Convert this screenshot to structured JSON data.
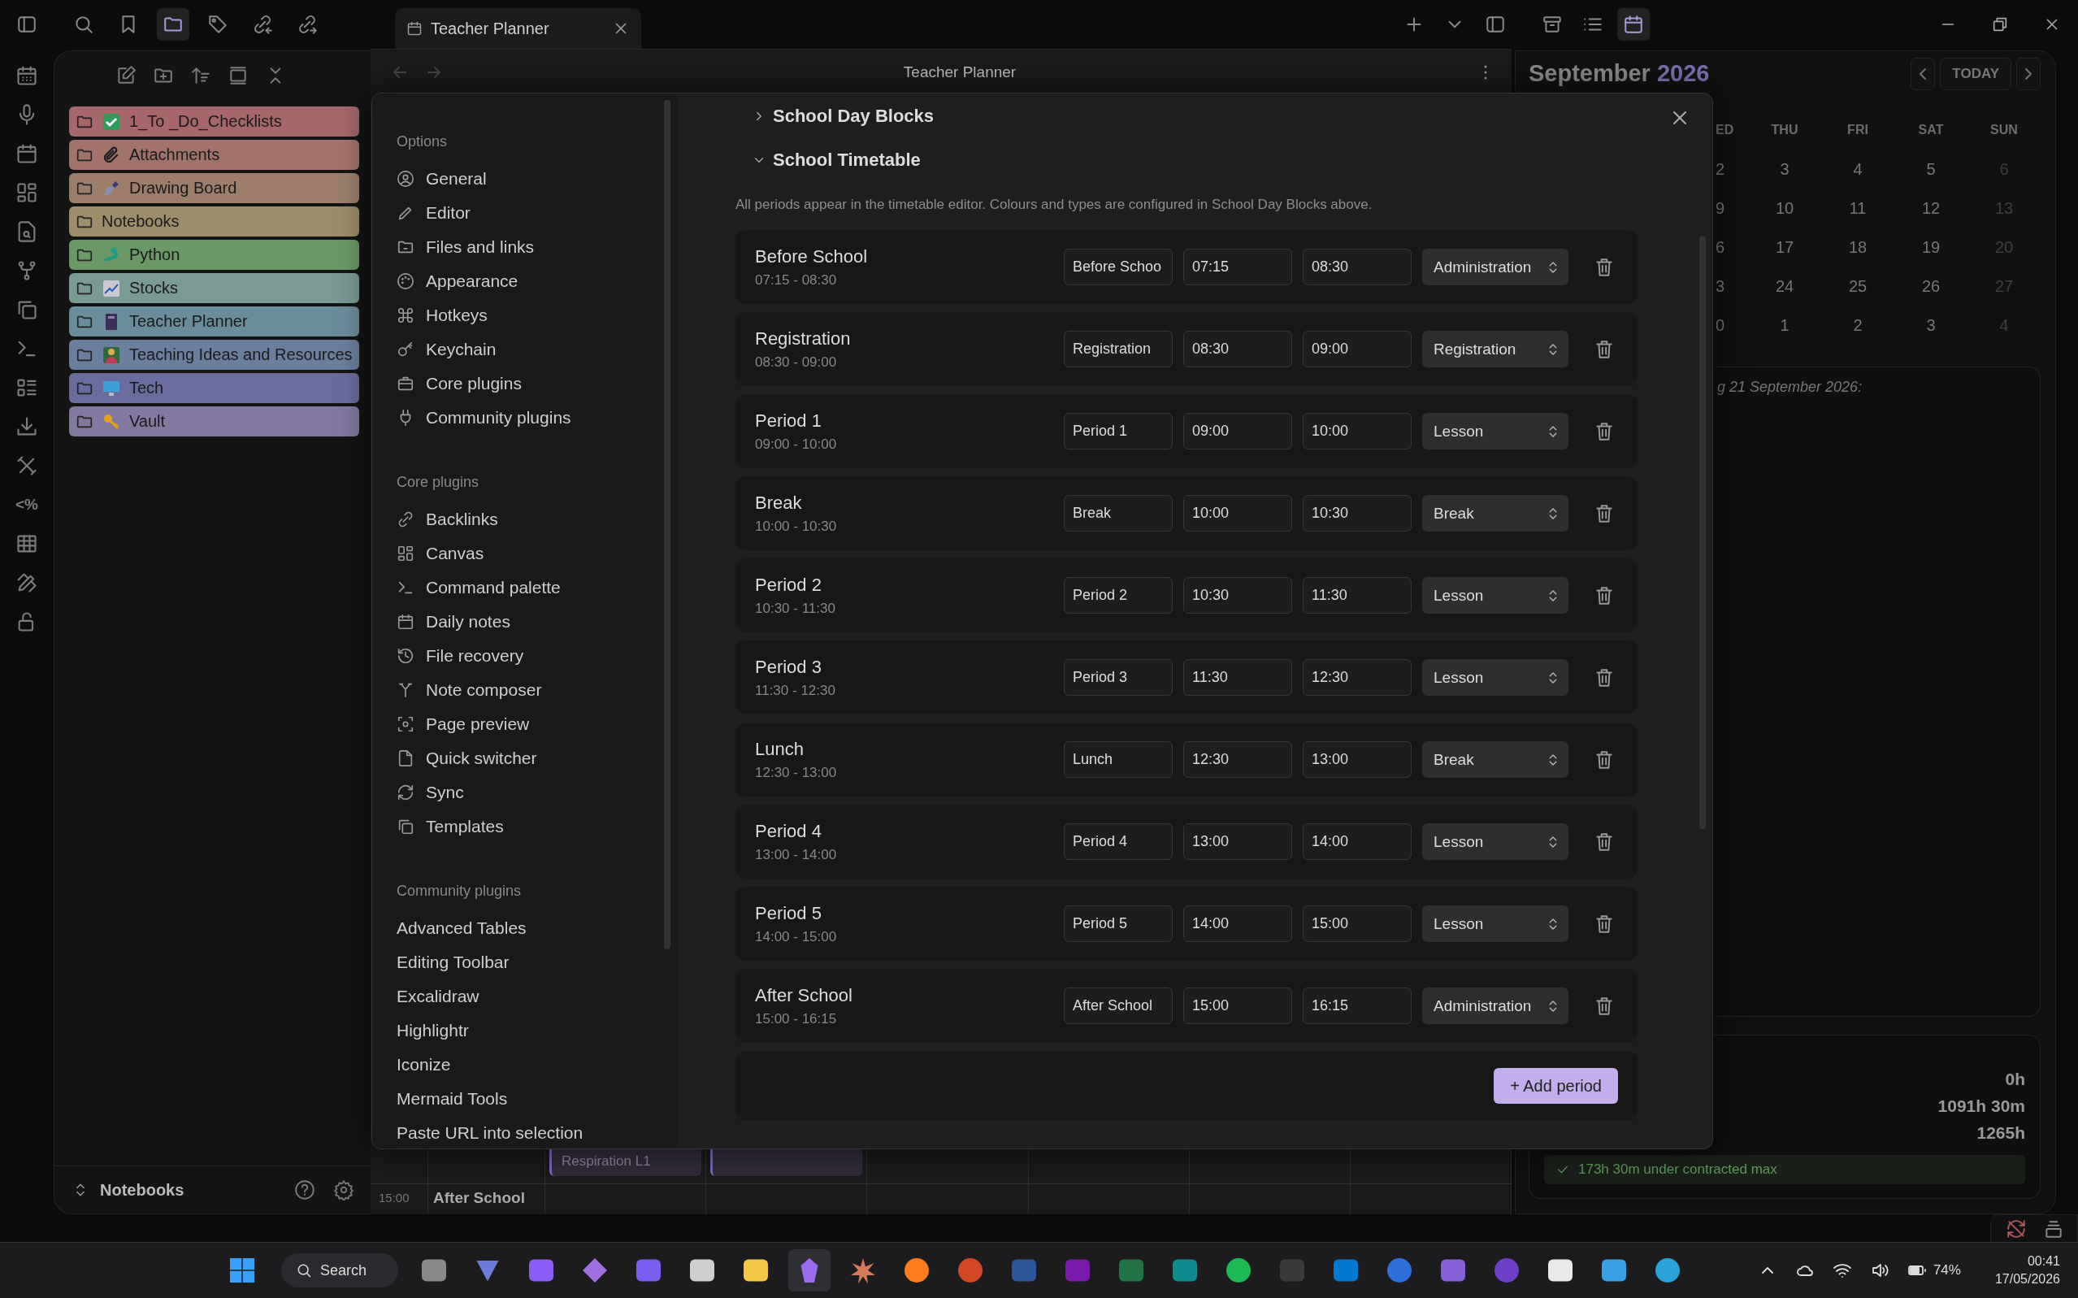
{
  "top_bar": {
    "tabs": [
      {
        "label": "Teacher Planner",
        "selected": true
      }
    ]
  },
  "ribbon": {
    "text_icon": "<%"
  },
  "file_explorer": {
    "folders": [
      {
        "name": "1_To _Do_Checklists",
        "color": "#a5676a"
      },
      {
        "name": "Attachments",
        "color": "#a2736b"
      },
      {
        "name": "Drawing Board",
        "color": "#9c7e6b"
      },
      {
        "name": "Notebooks",
        "color": "#9d8d69"
      },
      {
        "name": "Python",
        "color": "#6a9966"
      },
      {
        "name": "Stocks",
        "color": "#7a9a96"
      },
      {
        "name": "Teacher Planner",
        "color": "#6a8d9b"
      },
      {
        "name": "Teaching Ideas and Resources",
        "color": "#6a7f9f"
      },
      {
        "name": "Tech",
        "color": "#6a6c9e"
      },
      {
        "name": "Vault",
        "color": "#8278a0"
      }
    ],
    "vault": "Notebooks"
  },
  "view": {
    "title": "Teacher Planner",
    "timetable": {
      "time": "15:00",
      "row_label": "After School",
      "events": [
        {
          "kind": "titled",
          "title": "Respiration L1"
        },
        {
          "kind": "blank"
        }
      ]
    }
  },
  "settings_modal": {
    "nav": [
      {
        "heading": "Options",
        "items": [
          {
            "label": "General",
            "selected": false
          },
          {
            "label": "Editor",
            "selected": false
          },
          {
            "label": "Files and links",
            "selected": false
          },
          {
            "label": "Appearance",
            "selected": false
          },
          {
            "label": "Hotkeys",
            "selected": false
          },
          {
            "label": "Keychain",
            "selected": false
          },
          {
            "label": "Core plugins",
            "selected": false
          },
          {
            "label": "Community plugins",
            "selected": false
          }
        ]
      },
      {
        "heading": "Core plugins",
        "items": [
          {
            "label": "Backlinks",
            "selected": false
          },
          {
            "label": "Canvas",
            "selected": false
          },
          {
            "label": "Command palette",
            "selected": false
          },
          {
            "label": "Daily notes",
            "selected": false
          },
          {
            "label": "File recovery",
            "selected": false
          },
          {
            "label": "Note composer",
            "selected": false
          },
          {
            "label": "Page preview",
            "selected": false
          },
          {
            "label": "Quick switcher",
            "selected": false
          },
          {
            "label": "Sync",
            "selected": false
          },
          {
            "label": "Templates",
            "selected": false
          }
        ]
      },
      {
        "heading": "Community plugins",
        "items": [
          {
            "label": "Advanced Tables",
            "selected": false
          },
          {
            "label": "Editing Toolbar",
            "selected": false
          },
          {
            "label": "Excalidraw",
            "selected": false
          },
          {
            "label": "Highlightr",
            "selected": false
          },
          {
            "label": "Iconize",
            "selected": false
          },
          {
            "label": "Mermaid Tools",
            "selected": false
          },
          {
            "label": "Paste URL into selection",
            "selected": false
          }
        ]
      }
    ],
    "sections": [
      {
        "title": "School Day Blocks",
        "expanded": false
      },
      {
        "title": "School Timetable",
        "expanded": true,
        "description": "All periods appear in the timetable editor. Colours and types are configured in School Day Blocks above.",
        "periods": [
          {
            "name": "Before School",
            "range": "07:15 - 08:30",
            "name_field": "Before Schoo",
            "start": "07:15",
            "end": "08:30",
            "type": "Administration"
          },
          {
            "name": "Registration",
            "range": "08:30 - 09:00",
            "name_field": "Registration",
            "start": "08:30",
            "end": "09:00",
            "type": "Registration"
          },
          {
            "name": "Period 1",
            "range": "09:00 - 10:00",
            "name_field": "Period 1",
            "start": "09:00",
            "end": "10:00",
            "type": "Lesson"
          },
          {
            "name": "Break",
            "range": "10:00 - 10:30",
            "name_field": "Break",
            "start": "10:00",
            "end": "10:30",
            "type": "Break"
          },
          {
            "name": "Period 2",
            "range": "10:30 - 11:30",
            "name_field": "Period 2",
            "start": "10:30",
            "end": "11:30",
            "type": "Lesson"
          },
          {
            "name": "Period 3",
            "range": "11:30 - 12:30",
            "name_field": "Period 3",
            "start": "11:30",
            "end": "12:30",
            "type": "Lesson"
          },
          {
            "name": "Lunch",
            "range": "12:30 - 13:00",
            "name_field": "Lunch",
            "start": "12:30",
            "end": "13:00",
            "type": "Break"
          },
          {
            "name": "Period 4",
            "range": "13:00 - 14:00",
            "name_field": "Period 4",
            "start": "13:00",
            "end": "14:00",
            "type": "Lesson"
          },
          {
            "name": "Period 5",
            "range": "14:00 - 15:00",
            "name_field": "Period 5",
            "start": "14:00",
            "end": "15:00",
            "type": "Lesson"
          },
          {
            "name": "After School",
            "range": "15:00 - 16:15",
            "name_field": "After School",
            "start": "15:00",
            "end": "16:15",
            "type": "Administration"
          }
        ],
        "add_button": "+ Add period"
      }
    ]
  },
  "calendar": {
    "month": "September",
    "year": "2026",
    "today_button": "TODAY",
    "weekdays": [
      "ED",
      "THU",
      "FRI",
      "SAT",
      "SUN"
    ],
    "weeks": [
      [
        {
          "day": "2",
          "muted": false
        },
        {
          "day": "3",
          "muted": false
        },
        {
          "day": "4",
          "muted": false
        },
        {
          "day": "5",
          "muted": false
        },
        {
          "day": "6",
          "muted": true
        }
      ],
      [
        {
          "day": "9",
          "muted": false
        },
        {
          "day": "10",
          "muted": false
        },
        {
          "day": "11",
          "muted": false
        },
        {
          "day": "12",
          "muted": false
        },
        {
          "day": "13",
          "muted": true
        }
      ],
      [
        {
          "day": "6",
          "muted": false
        },
        {
          "day": "17",
          "muted": false
        },
        {
          "day": "18",
          "muted": false
        },
        {
          "day": "19",
          "muted": false
        },
        {
          "day": "20",
          "muted": true
        }
      ],
      [
        {
          "day": "3",
          "muted": false
        },
        {
          "day": "24",
          "muted": false
        },
        {
          "day": "25",
          "muted": false
        },
        {
          "day": "26",
          "muted": false
        },
        {
          "day": "27",
          "muted": true
        }
      ],
      [
        {
          "day": "0",
          "muted": false
        },
        {
          "day": "1",
          "muted": false
        },
        {
          "day": "2",
          "muted": false
        },
        {
          "day": "3",
          "muted": false
        },
        {
          "day": "4",
          "muted": true
        }
      ]
    ]
  },
  "day_note": {
    "text": "g 21 September 2026:"
  },
  "hours_summary": {
    "values": [
      "0h",
      "1091h 30m",
      "1265h"
    ],
    "notice": "173h 30m under contracted max"
  },
  "taskbar": {
    "search": "Search",
    "battery": "74%",
    "time": "00:41",
    "date": "17/05/2026"
  }
}
